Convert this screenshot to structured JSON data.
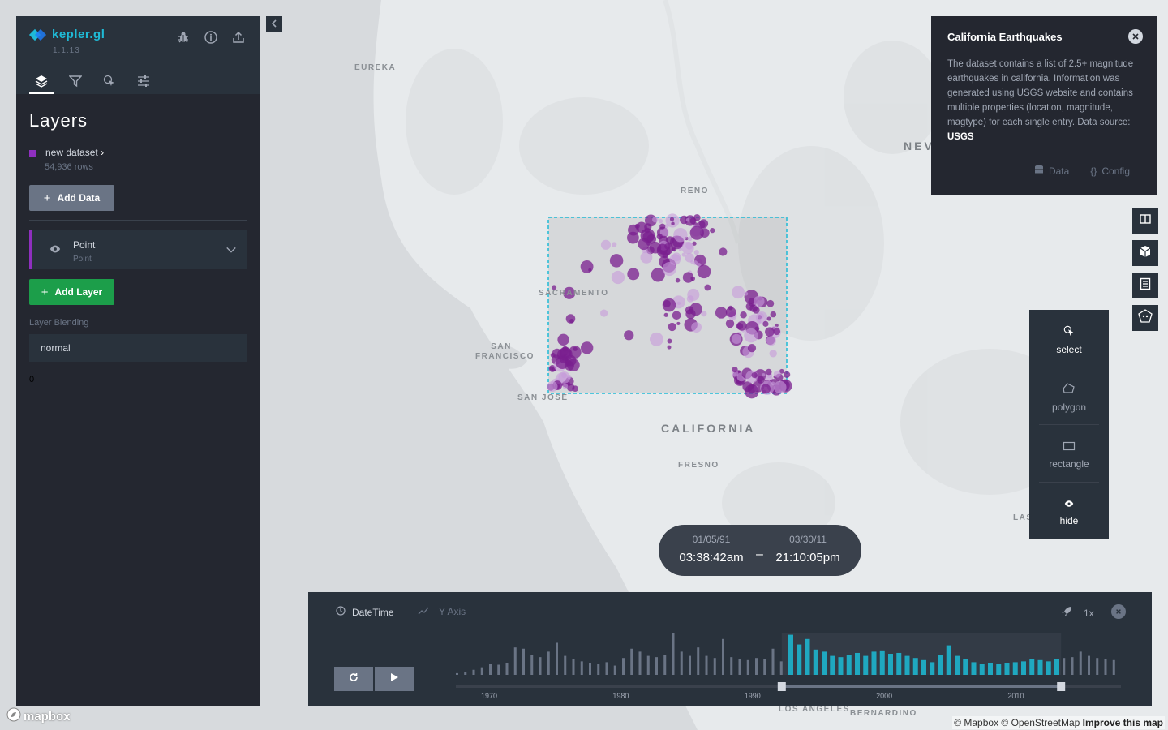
{
  "app": {
    "name": "kepler.gl",
    "version": "1.1.13"
  },
  "header_icons": [
    "bug-icon",
    "info-icon",
    "share-icon"
  ],
  "tabs": [
    {
      "name": "layers",
      "icon": "layers-icon",
      "active": true
    },
    {
      "name": "filters",
      "icon": "filter-icon",
      "active": false
    },
    {
      "name": "interactions",
      "icon": "cursor-icon",
      "active": false
    },
    {
      "name": "map-style",
      "icon": "sliders-icon",
      "active": false
    }
  ],
  "panel": {
    "title": "Layers",
    "dataset": {
      "name": "new dataset",
      "rows": "54,936 rows",
      "color": "#8f2fbf"
    },
    "add_data_label": "Add Data",
    "layer": {
      "name": "Point",
      "type": "Point"
    },
    "add_layer_label": "Add Layer",
    "blending_label": "Layer Blending",
    "blending_value": "normal",
    "stray_text": "0"
  },
  "map_labels": {
    "eureka": "EUREKA",
    "reno": "RENO",
    "sacramento": "SACRAMENTO",
    "san_francisco": "SAN FRANCISCO",
    "san_jose": "SAN JOSE",
    "california": "CALIFORNIA",
    "fresno": "FRESNO",
    "nevada": "NEV",
    "las": "LAS",
    "los_angeles": "LOS ANGELES",
    "bernardino": "BERNARDINO"
  },
  "info_panel": {
    "title": "California Earthquakes",
    "description": "The dataset contains a list of 2.5+ magnitude earthquakes in california. Information was generated using USGS website and contains multiple properties (location, magnitude, magtype) for each single entry. Data source:",
    "source": "USGS",
    "data_label": "Data",
    "config_label": "Config"
  },
  "map_controls": [
    "split-map-icon",
    "3d-map-icon",
    "legend-icon",
    "draw-polygon-icon"
  ],
  "draw_menu": {
    "select": "select",
    "polygon": "polygon",
    "rectangle": "rectangle",
    "hide": "hide"
  },
  "time_range": {
    "start_date": "01/05/91",
    "start_time": "03:38:42am",
    "end_date": "03/30/11",
    "end_time": "21:10:05pm",
    "separator": "–"
  },
  "timeline": {
    "field_label": "DateTime",
    "y_axis_label": "Y Axis",
    "speed": "1x",
    "axis_ticks": [
      "1970",
      "1980",
      "1990",
      "2000",
      "2010"
    ],
    "selected_range_fraction": [
      0.49,
      0.91
    ],
    "accent": "#1fa8c0",
    "histogram": [
      0.04,
      0.06,
      0.12,
      0.18,
      0.25,
      0.24,
      0.28,
      0.65,
      0.62,
      0.48,
      0.42,
      0.55,
      0.76,
      0.45,
      0.38,
      0.32,
      0.28,
      0.25,
      0.3,
      0.22,
      0.4,
      0.62,
      0.55,
      0.45,
      0.42,
      0.48,
      1.0,
      0.55,
      0.45,
      0.65,
      0.45,
      0.4,
      0.85,
      0.42,
      0.38,
      0.35,
      0.4,
      0.38,
      0.62,
      0.32,
      0.95,
      0.72,
      0.85,
      0.6,
      0.55,
      0.45,
      0.42,
      0.48,
      0.52,
      0.45,
      0.55,
      0.58,
      0.5,
      0.52,
      0.45,
      0.4,
      0.35,
      0.3,
      0.48,
      0.7,
      0.45,
      0.38,
      0.3,
      0.25,
      0.28,
      0.25,
      0.28,
      0.3,
      0.32,
      0.38,
      0.35,
      0.32,
      0.38,
      0.4,
      0.42,
      0.55,
      0.45,
      0.4,
      0.38,
      0.35
    ]
  },
  "attribution": {
    "mapbox": "mapbox",
    "text": "© Mapbox © OpenStreetMap",
    "improve": "Improve this map"
  }
}
